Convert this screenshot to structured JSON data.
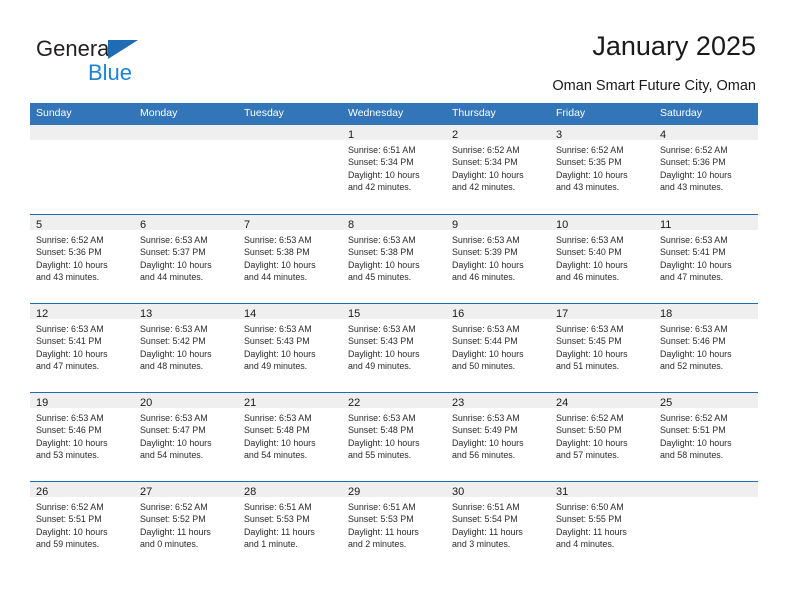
{
  "brand": {
    "name_part1": "General",
    "name_part2": "Blue",
    "accent_color": "#1b83d4",
    "triangle_color": "#1f6cb4"
  },
  "header": {
    "title": "January 2025",
    "subtitle": "Oman Smart Future City, Oman"
  },
  "calendar": {
    "header_bg": "#3275b8",
    "row_divider_color": "#1f6cb4",
    "daynum_band_bg": "#efefef",
    "weekdays": [
      "Sunday",
      "Monday",
      "Tuesday",
      "Wednesday",
      "Thursday",
      "Friday",
      "Saturday"
    ],
    "weeks": [
      [
        {
          "day": "",
          "lines": []
        },
        {
          "day": "",
          "lines": []
        },
        {
          "day": "",
          "lines": []
        },
        {
          "day": "1",
          "lines": [
            "Sunrise: 6:51 AM",
            "Sunset: 5:34 PM",
            "Daylight: 10 hours",
            "and 42 minutes."
          ]
        },
        {
          "day": "2",
          "lines": [
            "Sunrise: 6:52 AM",
            "Sunset: 5:34 PM",
            "Daylight: 10 hours",
            "and 42 minutes."
          ]
        },
        {
          "day": "3",
          "lines": [
            "Sunrise: 6:52 AM",
            "Sunset: 5:35 PM",
            "Daylight: 10 hours",
            "and 43 minutes."
          ]
        },
        {
          "day": "4",
          "lines": [
            "Sunrise: 6:52 AM",
            "Sunset: 5:36 PM",
            "Daylight: 10 hours",
            "and 43 minutes."
          ]
        }
      ],
      [
        {
          "day": "5",
          "lines": [
            "Sunrise: 6:52 AM",
            "Sunset: 5:36 PM",
            "Daylight: 10 hours",
            "and 43 minutes."
          ]
        },
        {
          "day": "6",
          "lines": [
            "Sunrise: 6:53 AM",
            "Sunset: 5:37 PM",
            "Daylight: 10 hours",
            "and 44 minutes."
          ]
        },
        {
          "day": "7",
          "lines": [
            "Sunrise: 6:53 AM",
            "Sunset: 5:38 PM",
            "Daylight: 10 hours",
            "and 44 minutes."
          ]
        },
        {
          "day": "8",
          "lines": [
            "Sunrise: 6:53 AM",
            "Sunset: 5:38 PM",
            "Daylight: 10 hours",
            "and 45 minutes."
          ]
        },
        {
          "day": "9",
          "lines": [
            "Sunrise: 6:53 AM",
            "Sunset: 5:39 PM",
            "Daylight: 10 hours",
            "and 46 minutes."
          ]
        },
        {
          "day": "10",
          "lines": [
            "Sunrise: 6:53 AM",
            "Sunset: 5:40 PM",
            "Daylight: 10 hours",
            "and 46 minutes."
          ]
        },
        {
          "day": "11",
          "lines": [
            "Sunrise: 6:53 AM",
            "Sunset: 5:41 PM",
            "Daylight: 10 hours",
            "and 47 minutes."
          ]
        }
      ],
      [
        {
          "day": "12",
          "lines": [
            "Sunrise: 6:53 AM",
            "Sunset: 5:41 PM",
            "Daylight: 10 hours",
            "and 47 minutes."
          ]
        },
        {
          "day": "13",
          "lines": [
            "Sunrise: 6:53 AM",
            "Sunset: 5:42 PM",
            "Daylight: 10 hours",
            "and 48 minutes."
          ]
        },
        {
          "day": "14",
          "lines": [
            "Sunrise: 6:53 AM",
            "Sunset: 5:43 PM",
            "Daylight: 10 hours",
            "and 49 minutes."
          ]
        },
        {
          "day": "15",
          "lines": [
            "Sunrise: 6:53 AM",
            "Sunset: 5:43 PM",
            "Daylight: 10 hours",
            "and 49 minutes."
          ]
        },
        {
          "day": "16",
          "lines": [
            "Sunrise: 6:53 AM",
            "Sunset: 5:44 PM",
            "Daylight: 10 hours",
            "and 50 minutes."
          ]
        },
        {
          "day": "17",
          "lines": [
            "Sunrise: 6:53 AM",
            "Sunset: 5:45 PM",
            "Daylight: 10 hours",
            "and 51 minutes."
          ]
        },
        {
          "day": "18",
          "lines": [
            "Sunrise: 6:53 AM",
            "Sunset: 5:46 PM",
            "Daylight: 10 hours",
            "and 52 minutes."
          ]
        }
      ],
      [
        {
          "day": "19",
          "lines": [
            "Sunrise: 6:53 AM",
            "Sunset: 5:46 PM",
            "Daylight: 10 hours",
            "and 53 minutes."
          ]
        },
        {
          "day": "20",
          "lines": [
            "Sunrise: 6:53 AM",
            "Sunset: 5:47 PM",
            "Daylight: 10 hours",
            "and 54 minutes."
          ]
        },
        {
          "day": "21",
          "lines": [
            "Sunrise: 6:53 AM",
            "Sunset: 5:48 PM",
            "Daylight: 10 hours",
            "and 54 minutes."
          ]
        },
        {
          "day": "22",
          "lines": [
            "Sunrise: 6:53 AM",
            "Sunset: 5:48 PM",
            "Daylight: 10 hours",
            "and 55 minutes."
          ]
        },
        {
          "day": "23",
          "lines": [
            "Sunrise: 6:53 AM",
            "Sunset: 5:49 PM",
            "Daylight: 10 hours",
            "and 56 minutes."
          ]
        },
        {
          "day": "24",
          "lines": [
            "Sunrise: 6:52 AM",
            "Sunset: 5:50 PM",
            "Daylight: 10 hours",
            "and 57 minutes."
          ]
        },
        {
          "day": "25",
          "lines": [
            "Sunrise: 6:52 AM",
            "Sunset: 5:51 PM",
            "Daylight: 10 hours",
            "and 58 minutes."
          ]
        }
      ],
      [
        {
          "day": "26",
          "lines": [
            "Sunrise: 6:52 AM",
            "Sunset: 5:51 PM",
            "Daylight: 10 hours",
            "and 59 minutes."
          ]
        },
        {
          "day": "27",
          "lines": [
            "Sunrise: 6:52 AM",
            "Sunset: 5:52 PM",
            "Daylight: 11 hours",
            "and 0 minutes."
          ]
        },
        {
          "day": "28",
          "lines": [
            "Sunrise: 6:51 AM",
            "Sunset: 5:53 PM",
            "Daylight: 11 hours",
            "and 1 minute."
          ]
        },
        {
          "day": "29",
          "lines": [
            "Sunrise: 6:51 AM",
            "Sunset: 5:53 PM",
            "Daylight: 11 hours",
            "and 2 minutes."
          ]
        },
        {
          "day": "30",
          "lines": [
            "Sunrise: 6:51 AM",
            "Sunset: 5:54 PM",
            "Daylight: 11 hours",
            "and 3 minutes."
          ]
        },
        {
          "day": "31",
          "lines": [
            "Sunrise: 6:50 AM",
            "Sunset: 5:55 PM",
            "Daylight: 11 hours",
            "and 4 minutes."
          ]
        },
        {
          "day": "",
          "lines": []
        }
      ]
    ]
  }
}
